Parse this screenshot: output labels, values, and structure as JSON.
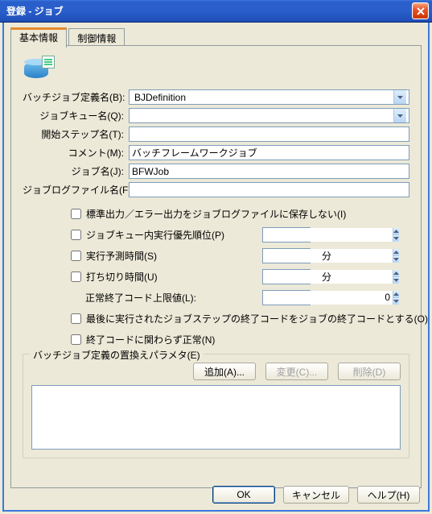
{
  "window": {
    "title": "登録 - ジョブ"
  },
  "tabs": {
    "active": "基本情報",
    "items": [
      "基本情報",
      "制御情報"
    ]
  },
  "form": {
    "batchJobDefName": {
      "label": "バッチジョブ定義名(B):",
      "value": "BJDefinition"
    },
    "jobQueueName": {
      "label": "ジョブキュー名(Q):",
      "value": ""
    },
    "startStepName": {
      "label": "開始ステップ名(T):",
      "value": ""
    },
    "comment": {
      "label": "コメント(M):",
      "value": "バッチフレームワークジョブ"
    },
    "jobName": {
      "label": "ジョブ名(J):",
      "value": "BFWJob"
    },
    "jobLogFileName": {
      "label": "ジョブログファイル名(F):",
      "value": ""
    }
  },
  "checks": {
    "noSaveStdOutErr": {
      "label": "標準出力／エラー出力をジョブログファイルに保存しない(I)",
      "checked": false
    },
    "priorityInQueue": {
      "label": "ジョブキュー内実行優先順位(P)",
      "checked": false,
      "value": ""
    },
    "estimatedTime": {
      "label": "実行予測時間(S)",
      "checked": false,
      "value": "",
      "unit": "分"
    },
    "cutoffTime": {
      "label": "打ち切り時間(U)",
      "checked": false,
      "value": "",
      "unit": "分"
    },
    "normalExitMax": {
      "label": "正常終了コード上限値(L):",
      "value": "0"
    },
    "lastStepExitAsJob": {
      "label": "最後に実行されたジョブステップの終了コードをジョブの終了コードとする(O)",
      "checked": false
    },
    "alwaysNormal": {
      "label": "終了コードに関わらず正常(N)",
      "checked": false
    }
  },
  "groupbox": {
    "legend": "バッチジョブ定義の置換えパラメタ(E)",
    "buttons": {
      "add": "追加(A)...",
      "change": "変更(C)...",
      "delete": "削除(D)"
    }
  },
  "bottomButtons": {
    "ok": "OK",
    "cancel": "キャンセル",
    "help": "ヘルプ(H)"
  }
}
